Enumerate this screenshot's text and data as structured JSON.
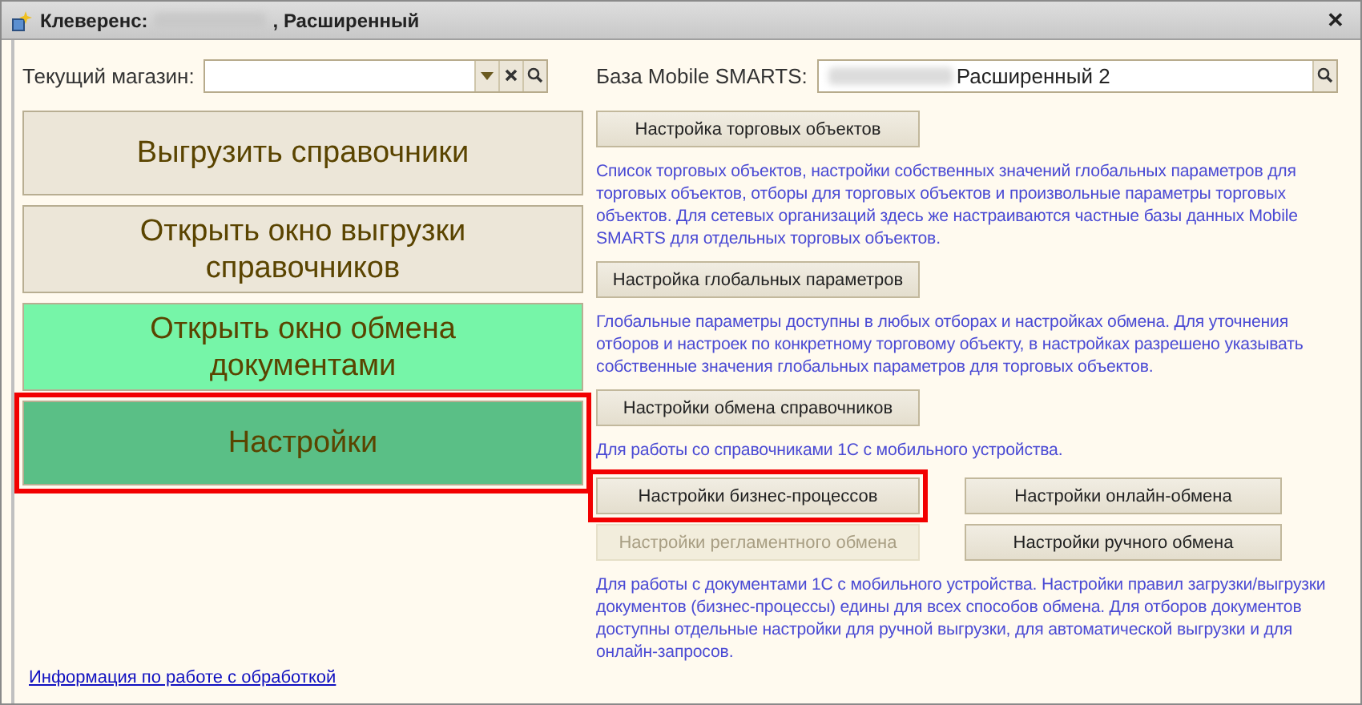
{
  "window": {
    "title_prefix": "Клеверенс:",
    "title_suffix": ", Расширенный",
    "close": "✕"
  },
  "store_field": {
    "label": "Текущий магазин:"
  },
  "base_field": {
    "label": "База Mobile SMARTS:",
    "value": "Расширенный 2",
    "value_hidden": true
  },
  "left_buttons": [
    {
      "label": "Выгрузить справочники",
      "color": "#ece6d8",
      "highlighted": false
    },
    {
      "label": "Открыть окно выгрузки справочников",
      "color": "#ece6d8",
      "highlighted": false
    },
    {
      "label": "Открыть окно обмена документами",
      "color": "#76f5a8",
      "highlighted": false
    },
    {
      "label": "Настройки",
      "color": "#5abf86",
      "highlighted": true
    }
  ],
  "info_link": "Информация по работе с обработкой",
  "sections": [
    {
      "kind": "single",
      "buttons": [
        {
          "label": "Настройка торговых объектов",
          "disabled": false,
          "highlighted": false
        }
      ],
      "description": "Список торговых объектов, настройки собственных значений глобальных параметров для торговых объектов, отборы для торговых объектов и произвольные параметры торговых объектов. Для сетевых организаций здесь же настраиваются частные базы данных Mobile SMARTS для отдельных торговых объектов."
    },
    {
      "kind": "single",
      "buttons": [
        {
          "label": "Настройка глобальных параметров",
          "disabled": false,
          "highlighted": false
        }
      ],
      "description": "Глобальные параметры доступны в любых отборах и настройках обмена. Для уточнения отборов и настроек по конкретному торговому объекту, в настройках разрешено указывать собственные значения глобальных параметров для торговых объектов."
    },
    {
      "kind": "single",
      "buttons": [
        {
          "label": "Настройки обмена справочников",
          "disabled": false,
          "highlighted": false
        }
      ],
      "description": "Для работы со справочниками 1С с мобильного устройства."
    },
    {
      "kind": "grid",
      "buttons": [
        {
          "label": "Настройки бизнес-процессов",
          "disabled": false,
          "highlighted": true
        },
        {
          "label": "Настройки онлайн-обмена",
          "disabled": false,
          "highlighted": false
        },
        {
          "label": "Настройки регламентного обмена",
          "disabled": true,
          "highlighted": false
        },
        {
          "label": "Настройки ручного обмена",
          "disabled": false,
          "highlighted": false
        }
      ],
      "description": "Для работы с документами 1С с мобильного устройства. Настройки правил загрузки/выгрузки документов (бизнес-процессы) едины для всех способов обмена. Для отборов документов доступны отдельные настройки для ручной выгрузки, для автоматической выгрузки и для онлайн-запросов."
    }
  ]
}
